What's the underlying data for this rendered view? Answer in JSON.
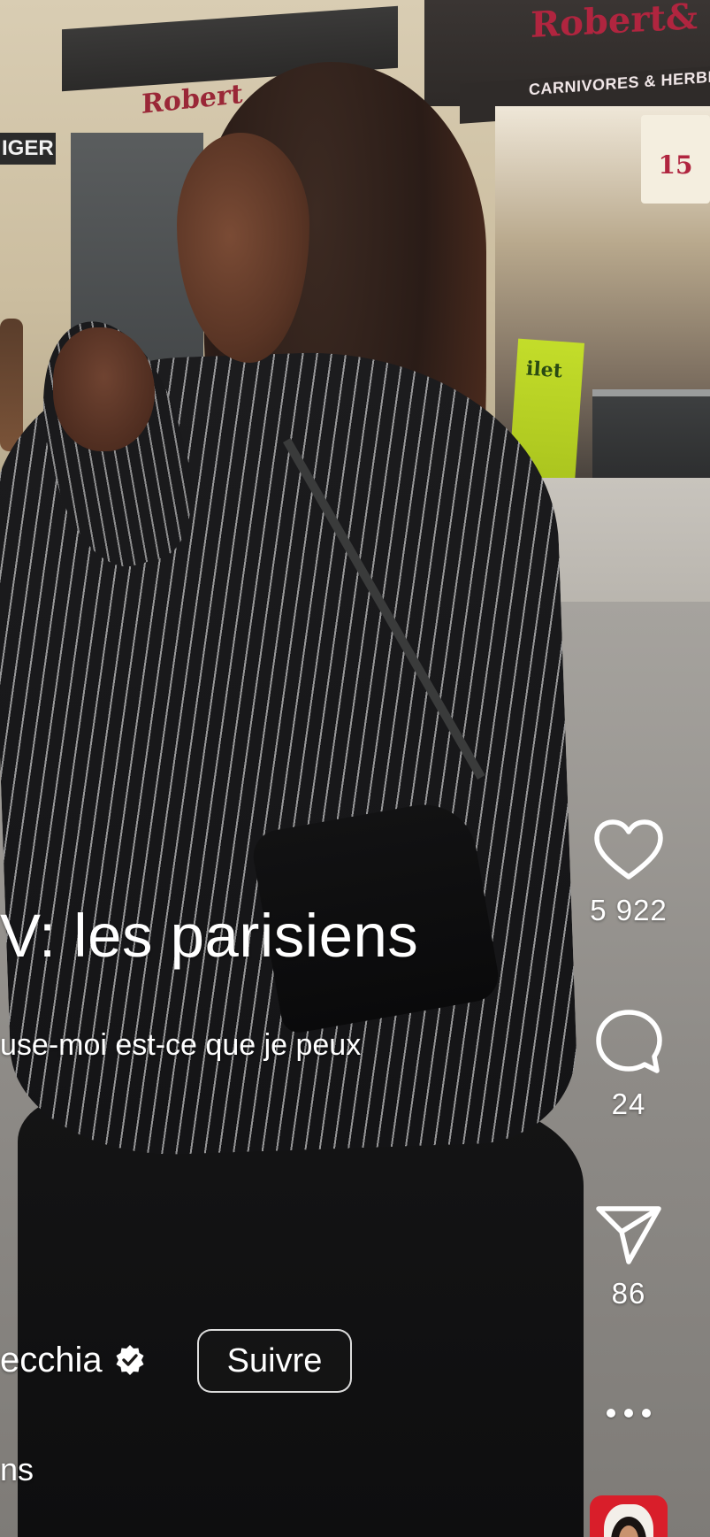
{
  "background": {
    "sign_right": "Robert&",
    "sign_left": "Robert",
    "sign_carnivores": "CARNIVORES & HERBI",
    "sign_roastif": "15",
    "sign_ger": "IGER",
    "sign_ilet": "ilet"
  },
  "caption": {
    "title": "V: les parisiens",
    "subtitle": "use-moi est-ce que je peux"
  },
  "author": {
    "name": "ecchia",
    "verified_icon": "verified-check-icon",
    "follow_label": "Suivre"
  },
  "audio": {
    "text": "ns"
  },
  "actions": {
    "like": {
      "icon": "heart-icon",
      "count": "5 922"
    },
    "comment": {
      "icon": "comment-bubble-icon",
      "count": "24"
    },
    "share": {
      "icon": "send-icon",
      "count": "86"
    },
    "more": {
      "icon": "more-dots-icon"
    },
    "music": {
      "icon": "audio-thumbnail"
    }
  },
  "colors": {
    "overlay_text": "#ffffff",
    "music_tile": "#d91e2a"
  }
}
